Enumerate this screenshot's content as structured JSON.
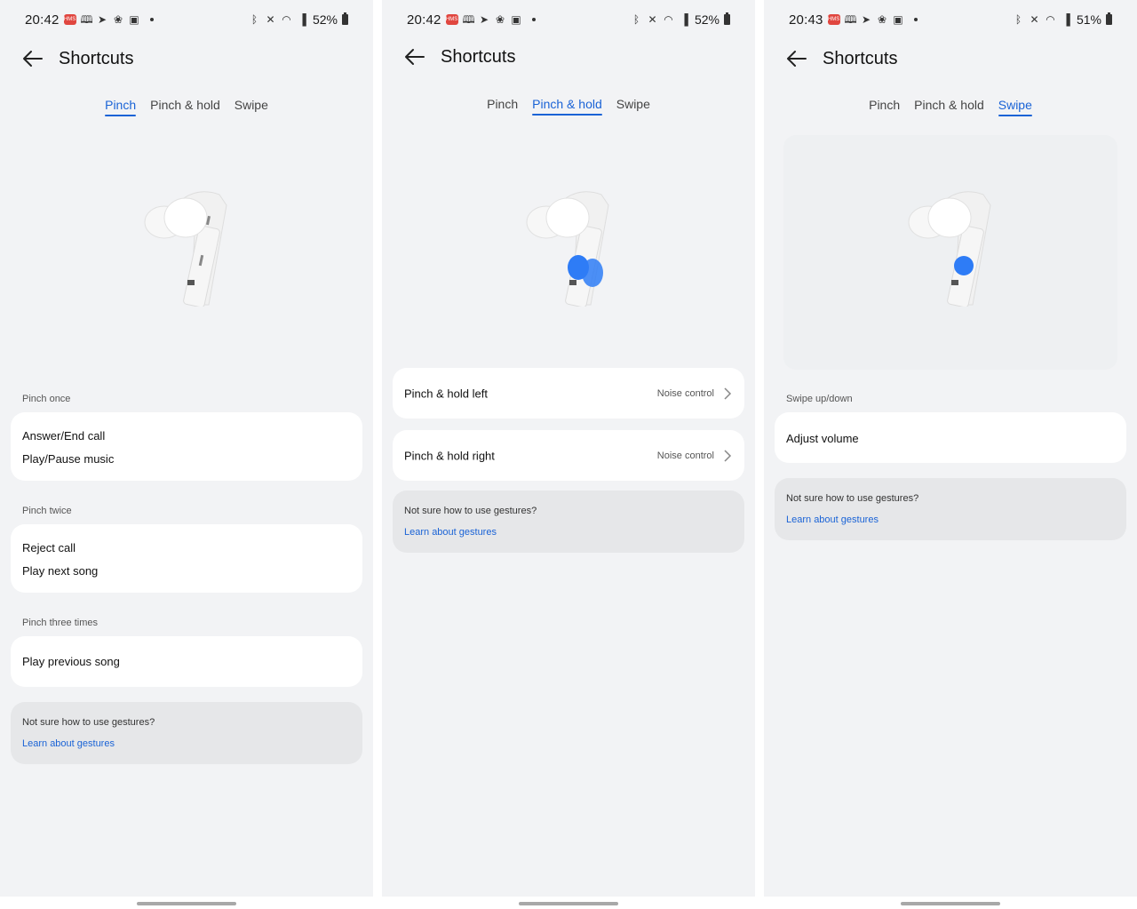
{
  "colors": {
    "accent": "#1a63d6",
    "background": "#f2f3f5",
    "card": "#ffffff",
    "help_card": "#e6e7e9",
    "touch_dot": "#2e7cf6"
  },
  "screens": [
    {
      "status": {
        "time": "20:42",
        "battery": "52%"
      },
      "title": "Shortcuts",
      "tabs": [
        "Pinch",
        "Pinch & hold",
        "Swipe"
      ],
      "active_tab": 0,
      "sections": [
        {
          "label": "Pinch once",
          "lines": [
            "Answer/End call",
            "Play/Pause music"
          ]
        },
        {
          "label": "Pinch twice",
          "lines": [
            "Reject call",
            "Play next song"
          ]
        },
        {
          "label": "Pinch three times",
          "lines": [
            "Play previous song"
          ]
        }
      ],
      "help": {
        "question": "Not sure how to use gestures?",
        "link": "Learn about gestures"
      }
    },
    {
      "status": {
        "time": "20:42",
        "battery": "52%"
      },
      "title": "Shortcuts",
      "tabs": [
        "Pinch",
        "Pinch & hold",
        "Swipe"
      ],
      "active_tab": 1,
      "rows": [
        {
          "label": "Pinch & hold left",
          "value": "Noise control"
        },
        {
          "label": "Pinch & hold right",
          "value": "Noise control"
        }
      ],
      "help": {
        "question": "Not sure how to use gestures?",
        "link": "Learn about gestures"
      }
    },
    {
      "status": {
        "time": "20:43",
        "battery": "51%"
      },
      "title": "Shortcuts",
      "tabs": [
        "Pinch",
        "Pinch & hold",
        "Swipe"
      ],
      "active_tab": 2,
      "sections": [
        {
          "label": "Swipe up/down",
          "lines": [
            "Adjust volume"
          ]
        }
      ],
      "help": {
        "question": "Not sure how to use gestures?",
        "link": "Learn about gestures"
      }
    }
  ],
  "icons": [
    "hms-icon",
    "book-icon",
    "telegram-icon",
    "pinwheel-icon",
    "gallery-icon",
    "bluetooth-icon",
    "mute-icon",
    "wifi-icon",
    "signal-icon",
    "battery-icon",
    "back-arrow-icon",
    "chevron-right-icon"
  ]
}
